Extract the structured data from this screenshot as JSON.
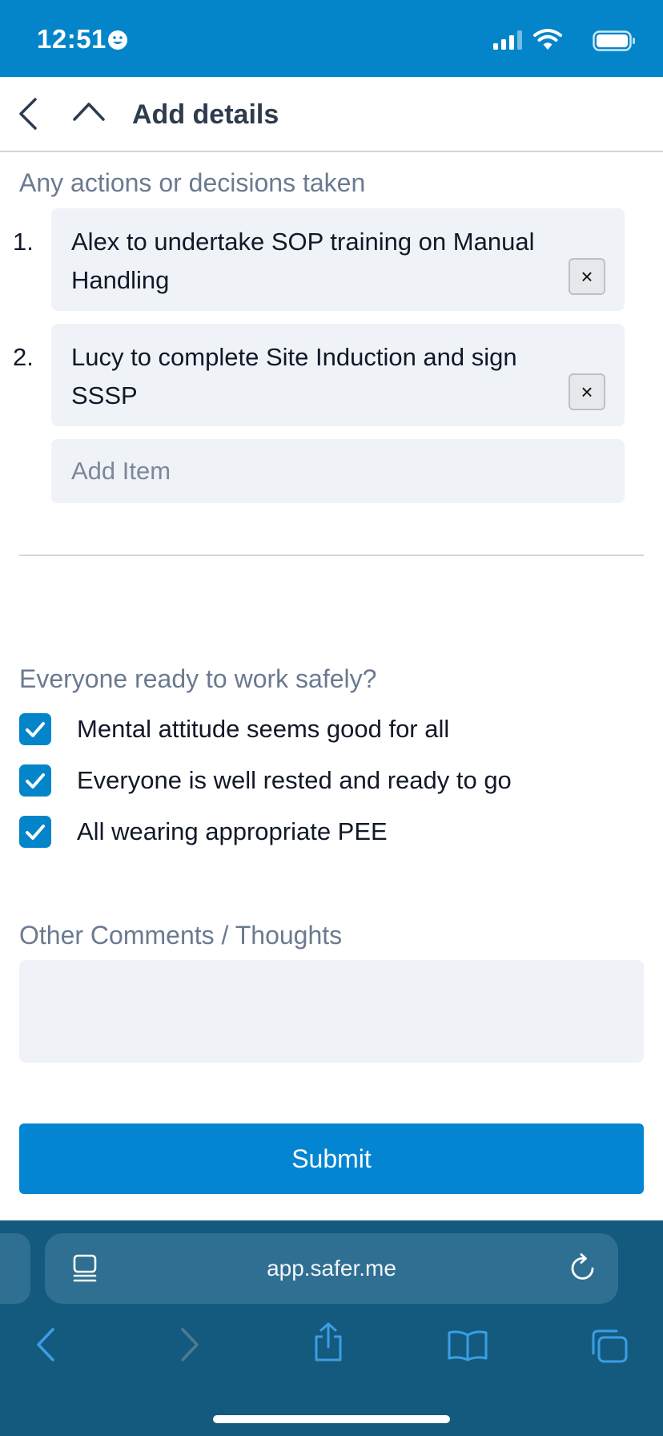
{
  "status_bar": {
    "time": "12:51"
  },
  "header": {
    "title": "Add details"
  },
  "actions": {
    "label": "Any actions or decisions taken",
    "items": [
      {
        "number": "1.",
        "text": "Alex to undertake SOP training on Manual Handling"
      },
      {
        "number": "2.",
        "text": "Lucy to complete Site Induction and sign SSSP"
      }
    ],
    "remove_label": "×",
    "add_placeholder": "Add Item"
  },
  "readiness": {
    "label": "Everyone ready to work safely?",
    "checks": [
      {
        "label": "Mental attitude seems good for all",
        "checked": true
      },
      {
        "label": "Everyone is well rested and ready to go",
        "checked": true
      },
      {
        "label": "All wearing appropriate PEE",
        "checked": true
      }
    ]
  },
  "comments": {
    "label": "Other Comments / Thoughts",
    "value": ""
  },
  "submit": {
    "label": "Submit"
  },
  "browser": {
    "url": "app.safer.me",
    "icons": [
      "reader-icon",
      "reload-icon",
      "back-arrow-icon",
      "forward-arrow-icon",
      "share-icon",
      "bookmarks-icon",
      "tabs-icon"
    ]
  },
  "colors": {
    "accent": "#0485c9",
    "status_bar": "#0485c9",
    "browser_toolbar": "#145a7e",
    "field_background": "#eff2f7",
    "label_gray": "#6b7a90",
    "browser_icon": "#3b9ee6"
  }
}
